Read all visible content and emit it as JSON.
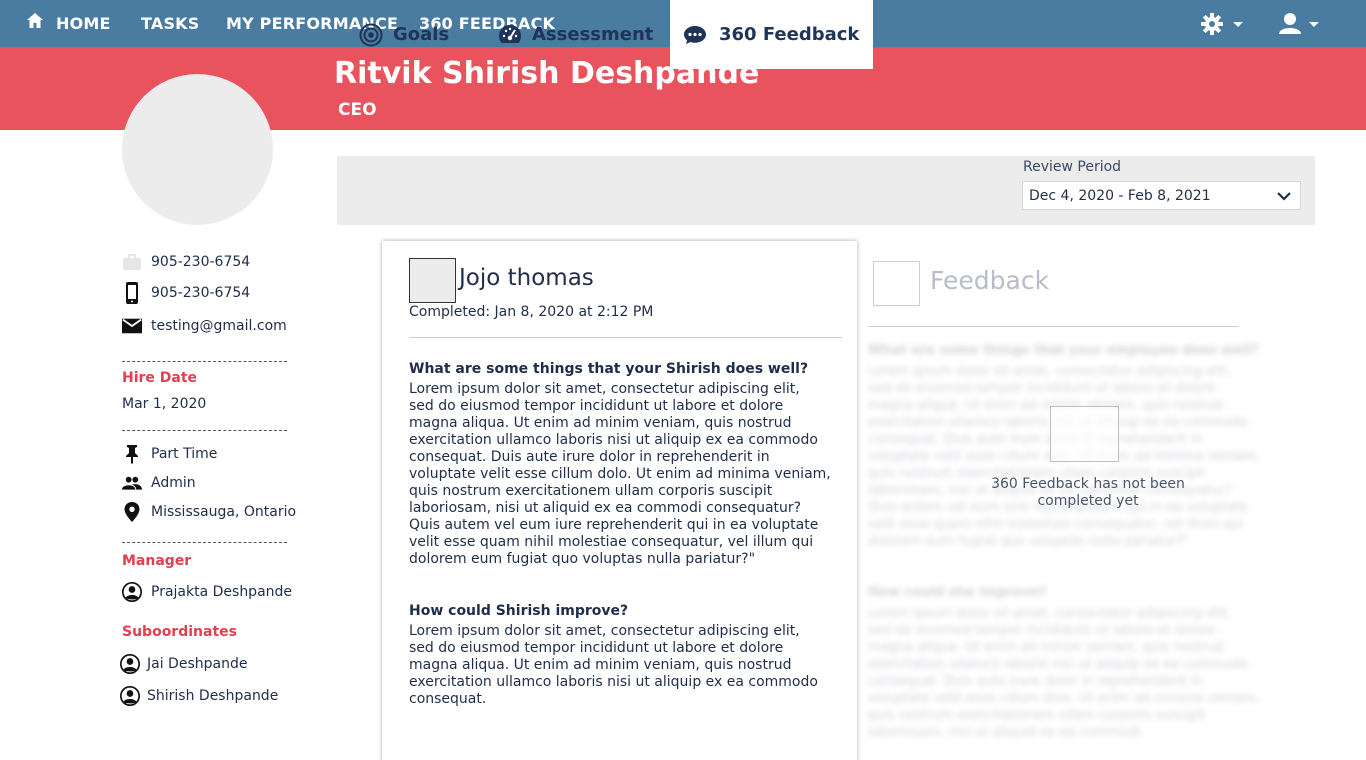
{
  "nav": {
    "home": "HOME",
    "tasks": "TASKS",
    "performance": "MY PERFORMANCE",
    "feedback": "360 FEEDBACK"
  },
  "profile": {
    "name": "Ritvik Shirish Deshpande",
    "title": "CEO"
  },
  "contact": {
    "work_phone": "905-230-6754",
    "mobile_phone": "905-230-6754",
    "email": "testing@gmail.com"
  },
  "hire": {
    "label": "Hire Date",
    "date": "Mar 1, 2020"
  },
  "details": {
    "employment_type": "Part Time",
    "role": "Admin",
    "location": "Mississauga, Ontario"
  },
  "manager": {
    "label": "Manager",
    "name": "Prajakta Deshpande"
  },
  "subordinates": {
    "label": "Suboordinates",
    "items": [
      "Jai Deshpande",
      "Shirish Deshpande"
    ]
  },
  "tabs": {
    "goals": "Goals",
    "assessment": "Assessment",
    "feedback": "360 Feedback"
  },
  "review": {
    "label": "Review Period",
    "value": "Dec 4, 2020 - Feb 8, 2021"
  },
  "card": {
    "reviewer": "Jojo thomas",
    "completed": "Completed: Jan 8, 2020 at 2:12 PM",
    "q1": "What are some things that your Shirish does well?",
    "a1": "Lorem ipsum dolor sit amet, consectetur adipiscing elit,\n sed do eiusmod tempor incididunt ut labore et dolore\n magna aliqua. Ut enim ad minim veniam, quis nostrud\n exercitation ullamco laboris nisi ut aliquip ex ea commodo\n consequat. Duis aute irure dolor in reprehenderit in\nvoluptate velit esse cillum dolo.  Ut enim ad minima veniam,\n quis nostrum exercitationem ullam corporis suscipit\nlaboriosam, nisi ut aliquid ex ea commodi consequatur?\n Quis autem vel eum iure reprehenderit qui in ea voluptate\n velit esse quam nihil molestiae consequatur, vel illum qui\ndolorem eum fugiat quo voluptas nulla pariatur?\"",
    "q2": "How could Shirish improve?",
    "a2": "Lorem ipsum dolor sit amet, consectetur adipiscing elit,\n sed do eiusmod tempor incididunt ut labore et dolore\n magna aliqua. Ut enim ad minim veniam, quis nostrud\n exercitation ullamco laboris nisi ut aliquip ex ea commodo\n consequat."
  },
  "self_feedback": {
    "title": "Feedback",
    "q1": "What are some things that your employee does well?",
    "a1": "Lorem ipsum dolor sit amet, consectetur adipiscing elit,\n sed do eiusmod tempor incididunt ut labore et dolore\n magna aliqua. Ut enim ad minim veniam, quis nostrud\n exercitation ullamco laboris nisi ut aliquip ex ea commodo\n consequat. Duis aute irure dolor in reprehenderit in\nvoluptate velit esse cillum dolo.  Ut enim ad minima veniam,\n quis nostrum exercitationem ullam corporis suscipit\nlaboriosam, nisi ut aliquid ex ea commodi consequatur?\n Quis autem vel eum iure reprehenderit qui in ea voluptate\n velit esse quam nihil molestiae consequatur, vel illum qui\ndolorem eum fugiat quo voluptas nulla pariatur?\"",
    "q2": "How could she improve?",
    "a2": "Lorem ipsum dolor sit amet, consectetur adipiscing elit,\n sed do eiusmod tempor incididunt ut labore et dolore\n magna aliqua. Ut enim ad minim veniam, quis nostrud\n exercitation ullamco laboris nisi ut aliquip ex ea commodo\n consequat. Duis aute irure dolor in reprehenderit in\nvoluptate velit esse cillum dolo.  Ut enim ad minima veniam,\n quis nostrum exercitationem ullam corporis suscipit\nlaboriosam, nisi ut aliquid ex ea commodi.",
    "empty_message": "360 Feedback has not been completed yet"
  },
  "colors": {
    "nav": "#4a7ba1",
    "banner": "#e9535e",
    "accent_label": "#e04050",
    "text": "#1f2d4a"
  },
  "icons": {
    "home": "home-icon",
    "settings": "gear-icon",
    "user": "user-icon",
    "work_phone": "briefcase-icon",
    "mobile": "mobile-phone-icon",
    "email": "envelope-icon",
    "pin": "pushpin-icon",
    "people": "people-icon",
    "location": "location-pin-icon",
    "goals": "target-icon",
    "assessment": "speedometer-icon",
    "feedback": "chat-bubble-icon"
  }
}
